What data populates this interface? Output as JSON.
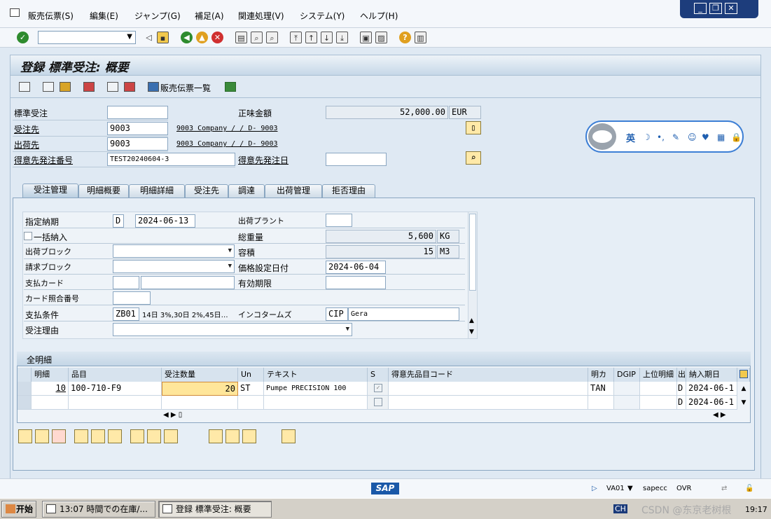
{
  "menu": {
    "items": [
      "販売伝票(S)",
      "編集(E)",
      "ジャンプ(G)",
      "補足(A)",
      "関連処理(V)",
      "システム(Y)",
      "ヘルプ(H)"
    ]
  },
  "window_controls": {
    "minimize": "_",
    "restore": "❐",
    "close": "✕"
  },
  "title": "登録 標準受注: 概要",
  "app_toolbar": {
    "doc_flow_label": "販売伝票一覧"
  },
  "header": {
    "order_type_label": "標準受注",
    "order_type_value": "",
    "net_value_label": "正味金額",
    "net_value": "52,000.00",
    "currency": "EUR",
    "sold_to_label": "受注先",
    "sold_to_value": "9003",
    "sold_to_desc": "9003 Company / / D- 9003",
    "ship_to_label": "出荷先",
    "ship_to_value": "9003",
    "ship_to_desc": "9003 Company / / D- 9003",
    "po_number_label": "得意先発注番号",
    "po_number_value": "TEST20240604-3",
    "po_date_label": "得意先発注日",
    "po_date_value": ""
  },
  "ime": {
    "lang": "英",
    "icons": [
      "☽",
      "•,",
      "✎",
      "☺",
      "♥",
      "▦",
      "🔒"
    ]
  },
  "tabs": [
    "受注管理",
    "明細概要",
    "明細詳細",
    "受注先",
    "調達",
    "出荷管理",
    "拒否理由"
  ],
  "sales_tab": {
    "req_deliv_date_label": "指定納期",
    "req_deliv_date_type": "D",
    "req_deliv_date": "2024-06-13",
    "delivering_plant_label": "出荷プラント",
    "delivering_plant": "",
    "complete_dlv_label": "一括納入",
    "total_weight_label": "総重量",
    "total_weight": "5,600",
    "weight_unit": "KG",
    "delivery_block_label": "出荷ブロック",
    "volume_label": "容積",
    "volume": "15",
    "volume_unit": "M3",
    "billing_block_label": "請求ブロック",
    "pricing_date_label": "価格設定日付",
    "pricing_date": "2024-06-04",
    "payment_card_label": "支払カード",
    "valid_to_label": "有効期限",
    "card_verif_label": "カード照合番号",
    "payment_terms_label": "支払条件",
    "payment_terms": "ZB01",
    "payment_terms_desc": "14日 3%,30日 2%,45日…",
    "incoterms_label": "インコタームズ",
    "incoterms": "CIP",
    "incoterms_loc": "Gera",
    "order_reason_label": "受注理由"
  },
  "items_table": {
    "title": "全明細",
    "columns": [
      "明細",
      "品目",
      "受注数量",
      "Un",
      "テキスト",
      "S",
      "得意先品目コード",
      "明カ",
      "DGIP",
      "上位明細",
      "出",
      "納入期日"
    ],
    "rows": [
      {
        "item": "10",
        "material": "100-710-F9",
        "qty": "20",
        "unit": "ST",
        "text": "Pumpe PRECISION 100",
        "cat": "TAN",
        "dlv": "D",
        "date": "2024-06-1"
      },
      {
        "item": "",
        "material": "",
        "qty": "",
        "unit": "",
        "text": "",
        "cat": "",
        "dlv": "D",
        "date": "2024-06-1"
      }
    ]
  },
  "status": {
    "transaction": "VA01",
    "system": "sapecc",
    "mode": "OVR",
    "sap": "SAP"
  },
  "taskbar": {
    "start": "开始",
    "btn1": "13:07 時間での在庫/...",
    "btn2": "登録 標準受注: 概要",
    "lang": "CH",
    "clock": "19:17",
    "watermark": "CSDN @东京老树根"
  }
}
